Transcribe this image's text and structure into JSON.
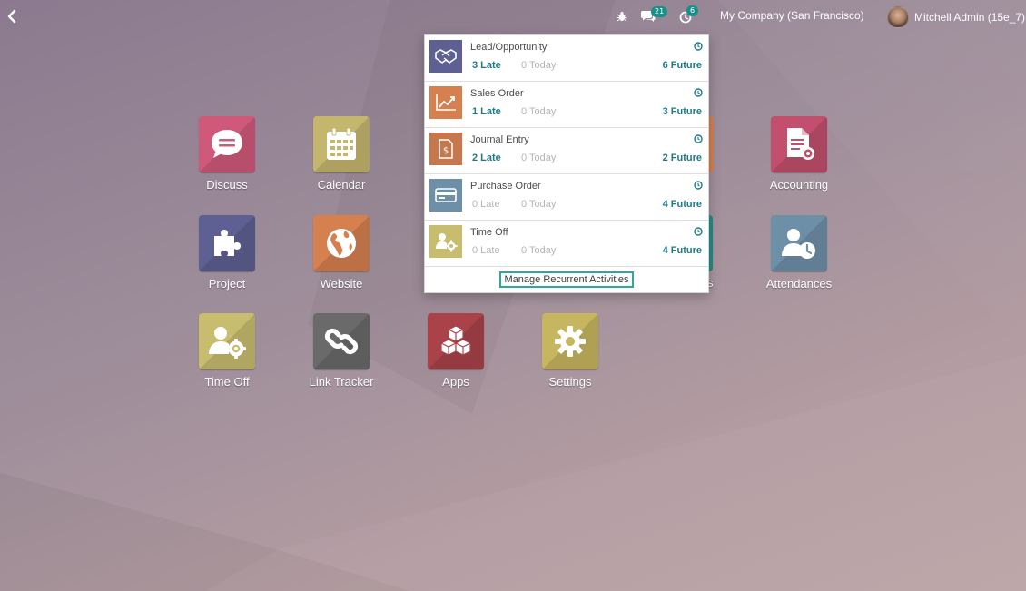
{
  "colors": {
    "accent": "#1e7b86",
    "badge": "#17908a",
    "discuss": "#d0597a",
    "calendar": "#c5b66e",
    "accounting": "#c24f6d",
    "project": "#5e5f92",
    "website": "#d6804f",
    "attendances": "#6e8fa8",
    "timeoff": "#c8bd6e",
    "linktracker": "#6a6a6a",
    "apps": "#a94249",
    "settings": "#c7b660"
  },
  "topbar": {
    "back_icon": "chevron-left-icon",
    "debug_icon": "bug-icon",
    "messages_icon": "chat-icon",
    "messages_count": "21",
    "activity_icon": "clock-icon",
    "activity_count": "6",
    "company": "My Company (San Francisco)",
    "user": "Mitchell Admin (15e_7)"
  },
  "apps": [
    {
      "label": "Discuss",
      "icon": "chat-bubble-icon"
    },
    {
      "label": "Calendar",
      "icon": "calendar-icon"
    },
    {
      "label": "Accounting",
      "icon": "invoice-gear-icon"
    },
    {
      "label": "Project",
      "icon": "puzzle-icon"
    },
    {
      "label": "Website",
      "icon": "globe-icon"
    },
    {
      "label": "Attendances",
      "icon": "user-clock-icon"
    },
    {
      "label": "Time Off",
      "icon": "user-gear-icon"
    },
    {
      "label": "Link Tracker",
      "icon": "link-icon"
    },
    {
      "label": "Apps",
      "icon": "cubes-icon"
    },
    {
      "label": "Settings",
      "icon": "gear-icon"
    }
  ],
  "hidden_partial_label": "s",
  "activities": {
    "items": [
      {
        "name": "Lead/Opportunity",
        "late": "3 Late",
        "today": "0 Today",
        "future": "6 Future",
        "icon": "handshake-icon",
        "late_active": true
      },
      {
        "name": "Sales Order",
        "late": "1 Late",
        "today": "0 Today",
        "future": "3 Future",
        "icon": "chart-up-icon",
        "late_active": true
      },
      {
        "name": "Journal Entry",
        "late": "2 Late",
        "today": "0 Today",
        "future": "2 Future",
        "icon": "dollar-doc-icon",
        "late_active": true
      },
      {
        "name": "Purchase Order",
        "late": "0 Late",
        "today": "0 Today",
        "future": "4 Future",
        "icon": "credit-card-icon",
        "late_active": false
      },
      {
        "name": "Time Off",
        "late": "0 Late",
        "today": "0 Today",
        "future": "4 Future",
        "icon": "user-gear-icon",
        "late_active": false
      }
    ],
    "manage_label": "Manage Recurrent Activities"
  }
}
